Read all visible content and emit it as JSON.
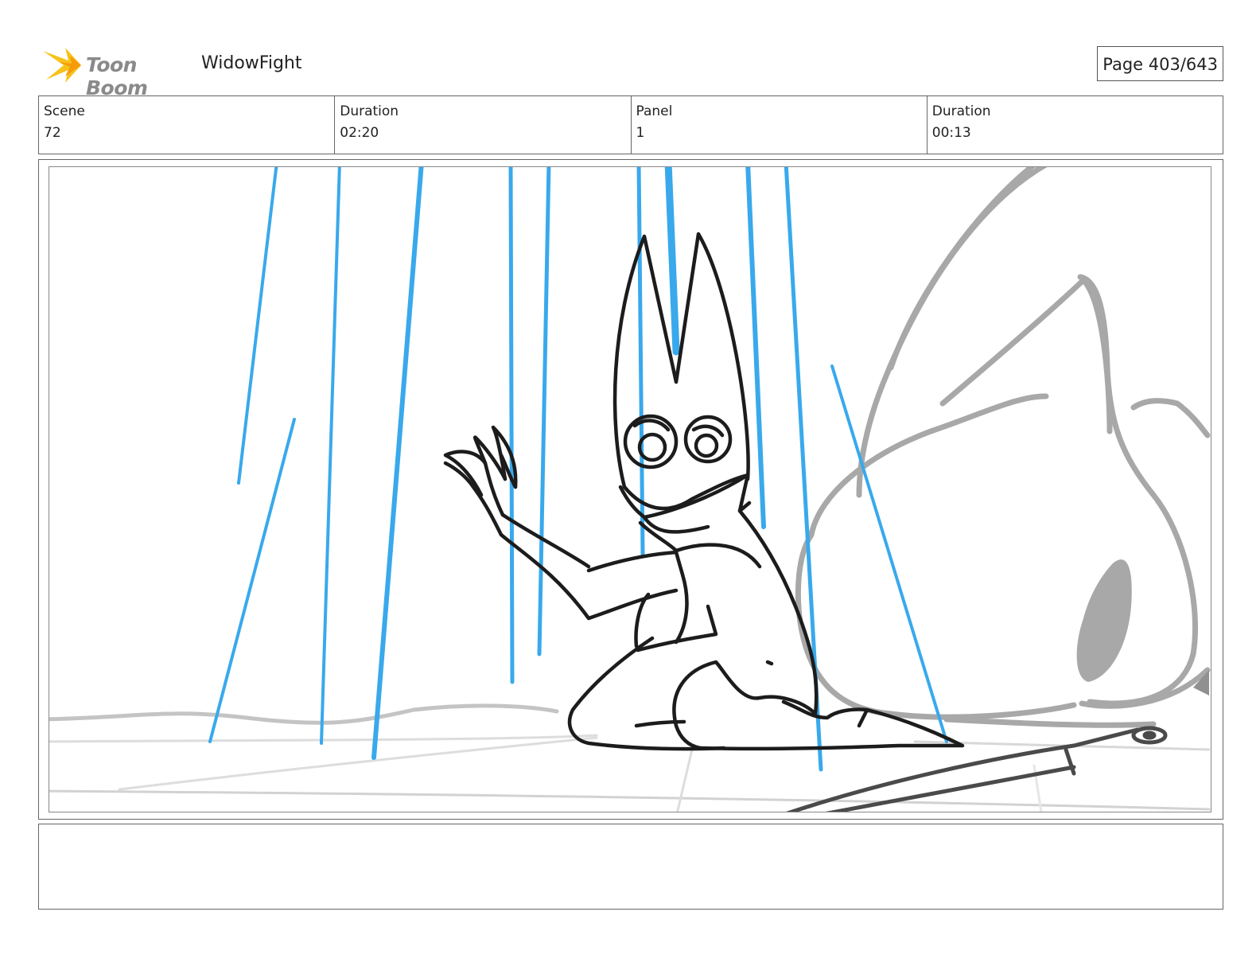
{
  "header": {
    "logo_text": "Toon Boom",
    "project_title": "WidowFight",
    "page_label": "Page 403/643"
  },
  "info": {
    "scene_label": "Scene",
    "scene_value": "72",
    "scene_duration_label": "Duration",
    "scene_duration_value": "02:20",
    "panel_label": "Panel",
    "panel_value": "1",
    "panel_duration_label": "Duration",
    "panel_duration_value": "00:13"
  },
  "notes": {
    "text": ""
  },
  "colors": {
    "rain": "#39a9ec",
    "ink": "#1c1c1c",
    "background_shape": "#a8a8a8",
    "logo_yellow": "#f7c21a"
  }
}
